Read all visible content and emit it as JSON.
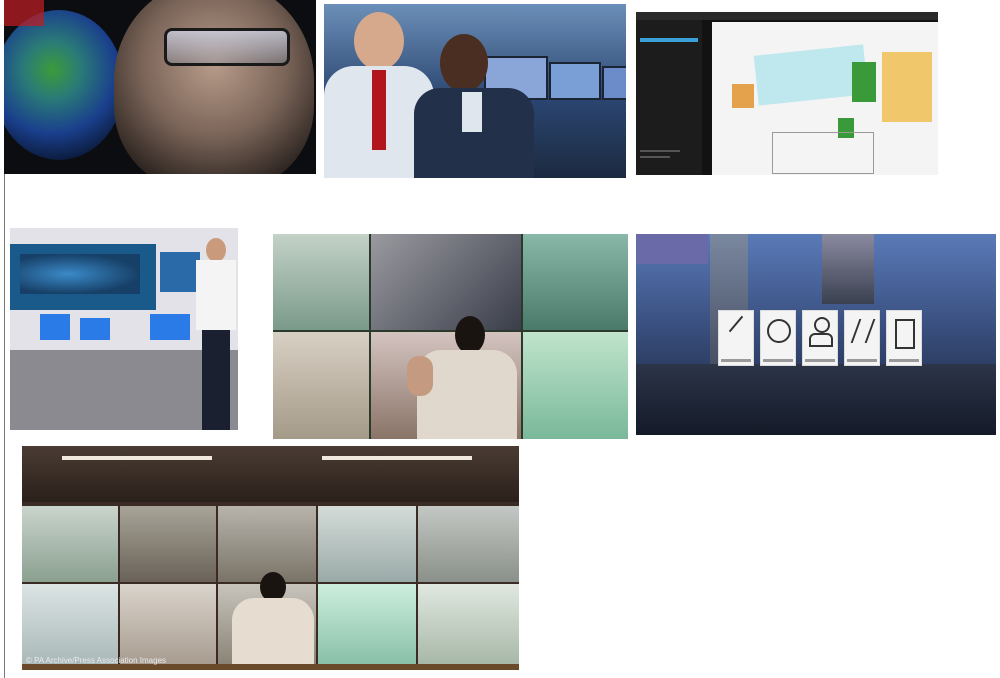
{
  "page": {
    "title": ""
  },
  "images": [
    {
      "id": "analyst-glasses-globe",
      "caption": ""
    },
    {
      "id": "operators-phone-monitors",
      "caption": ""
    },
    {
      "id": "floorplan-software",
      "caption": ""
    },
    {
      "id": "control-room-wall-map",
      "caption": ""
    },
    {
      "id": "city-surveillance-wall",
      "caption": ""
    },
    {
      "id": "city-skyline-icons",
      "caption": ""
    },
    {
      "id": "video-wall-operator",
      "caption": "© PA Archive/Press Association Images"
    }
  ],
  "colors": {
    "background": "#ffffff",
    "divider": "#7a7a7a"
  }
}
